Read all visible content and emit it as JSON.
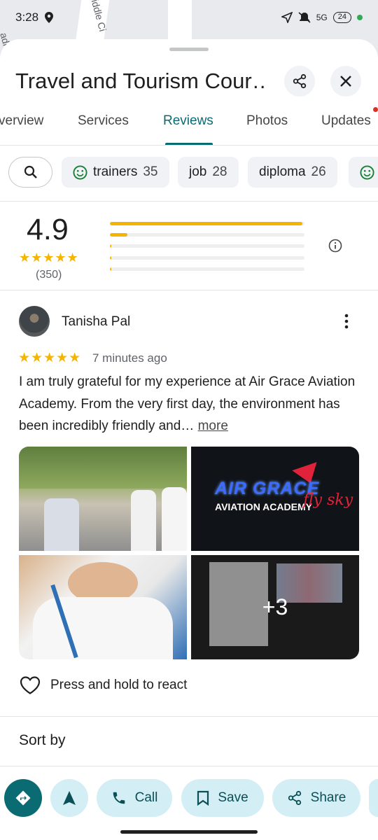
{
  "status_bar": {
    "time": "3:28",
    "network": "5G",
    "battery": "24"
  },
  "map": {
    "street_label": "iddle Ci",
    "edge_label": "adi"
  },
  "header": {
    "title": "Travel and Tourism Cour…"
  },
  "tabs": [
    {
      "label": "verview",
      "active": false
    },
    {
      "label": "Services",
      "active": false
    },
    {
      "label": "Reviews",
      "active": true
    },
    {
      "label": "Photos",
      "active": false
    },
    {
      "label": "Updates",
      "active": false
    }
  ],
  "chips": [
    {
      "label": "trainers",
      "count": "35",
      "icon": "smiley-icon"
    },
    {
      "label": "job",
      "count": "28"
    },
    {
      "label": "diploma",
      "count": "26"
    }
  ],
  "rating": {
    "score": "4.9",
    "stars": "★★★★★",
    "count": "(350)",
    "distribution": [
      0.99,
      0.09,
      0.003,
      0.003,
      0.003
    ]
  },
  "review": {
    "author": "Tanisha Pal",
    "stars": "★★★★★",
    "time": "7 minutes ago",
    "text": "I am truly grateful for my experience at Air Grace Aviation Academy. From the very first day, the environment has been incredibly friendly and…",
    "more": "more",
    "photos": {
      "logo_main": "AIR GRACE",
      "logo_sub": "AVIATION ACADEMY",
      "logo_script": "fly sky",
      "extra_count": "+3"
    },
    "react_label": "Press and hold to react"
  },
  "sort_label": "Sort by",
  "actions": {
    "call": "Call",
    "save": "Save",
    "share": "Share"
  },
  "colors": {
    "accent": "#0b6b73",
    "star": "#f4b400",
    "chip_bg": "#f0f2f5",
    "action_bg": "#d3eef4"
  }
}
